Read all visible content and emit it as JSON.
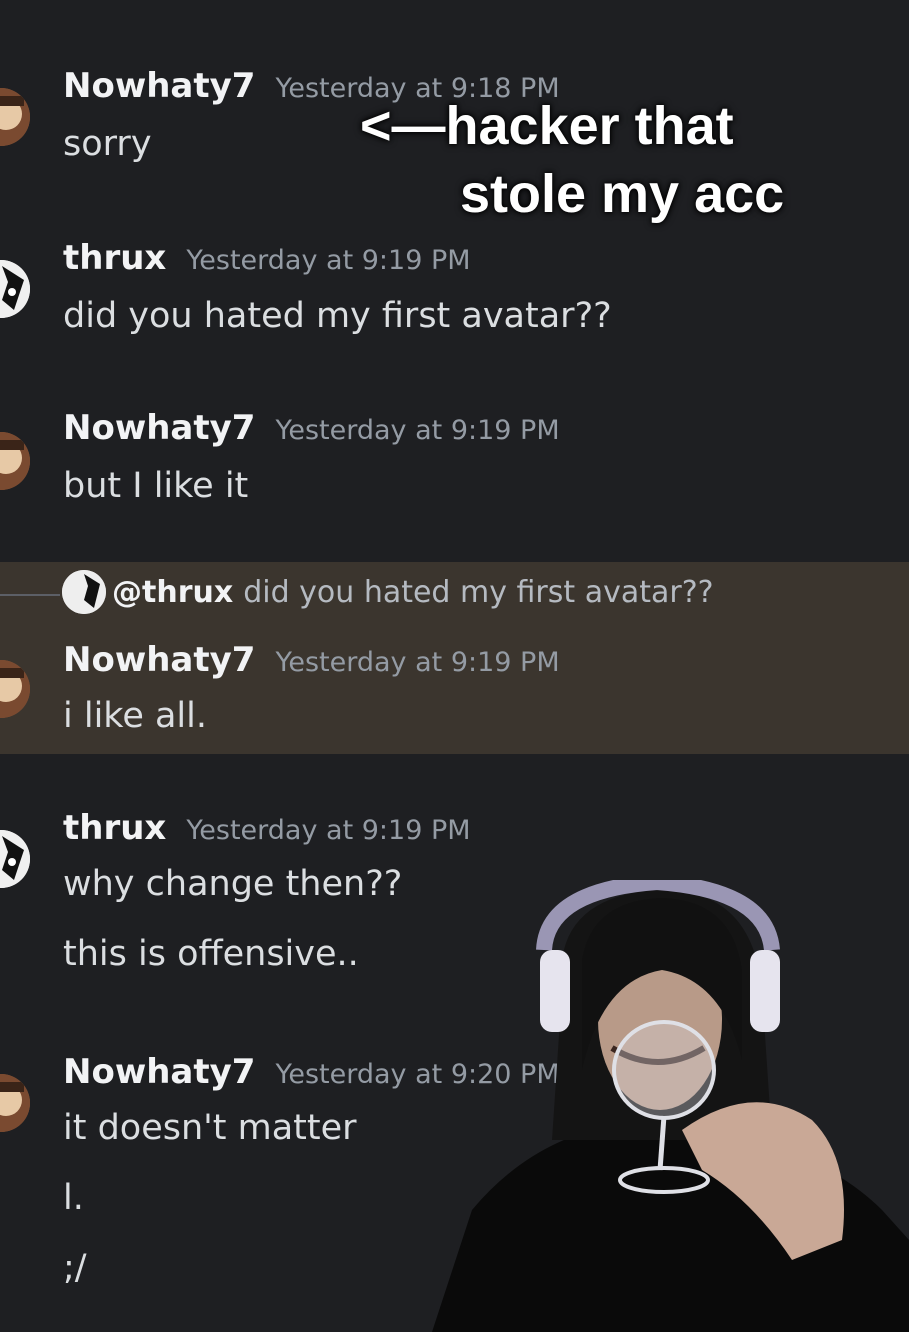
{
  "messages": [
    {
      "user": "Nowhaty7",
      "time": "Yesterday at 9:18 PM",
      "lines": [
        "sorry"
      ]
    },
    {
      "user": "thrux",
      "time": "Yesterday at 9:19 PM",
      "lines": [
        "did you hated my first avatar??"
      ]
    },
    {
      "user": "Nowhaty7",
      "time": "Yesterday at 9:19 PM",
      "lines": [
        "but I like it"
      ]
    },
    {
      "user": "Nowhaty7",
      "time": "Yesterday at 9:19 PM",
      "lines": [
        "i like all."
      ],
      "reply": {
        "mention": "@thrux",
        "text": "did you hated my first avatar??"
      }
    },
    {
      "user": "thrux",
      "time": "Yesterday at 9:19 PM",
      "lines": [
        "why change then??",
        "this is offensive.."
      ]
    },
    {
      "user": "Nowhaty7",
      "time": "Yesterday at 9:20 PM",
      "lines": [
        "it doesn't matter",
        "l.",
        ";/"
      ]
    }
  ],
  "overlay": {
    "caption_line1": "<—hacker that",
    "caption_line2": "stole my acc"
  },
  "colors": {
    "background": "#1e1f22",
    "reply_highlight": "#3b352e",
    "username": "#f2f3f5",
    "timestamp": "#949ba4",
    "message_text": "#dbdee1"
  }
}
